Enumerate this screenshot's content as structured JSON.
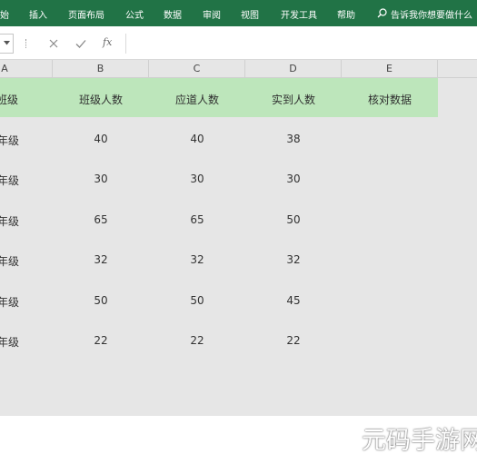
{
  "ribbon": {
    "tabs": [
      "始",
      "插入",
      "页面布局",
      "公式",
      "数据",
      "审阅",
      "视图",
      "开发工具",
      "帮助"
    ],
    "tell_me": "告诉我你想要做什么"
  },
  "formula_bar": {
    "fx_label": "fx",
    "value": ""
  },
  "columns": [
    "A",
    "B",
    "C",
    "D",
    "E"
  ],
  "header_row": [
    "班级",
    "班级人数",
    "应道人数",
    "实到人数",
    "核对数据"
  ],
  "rows": [
    {
      "grade": "年级",
      "class_size": "40",
      "expected": "40",
      "actual": "38"
    },
    {
      "grade": "年级",
      "class_size": "30",
      "expected": "30",
      "actual": "30"
    },
    {
      "grade": "年级",
      "class_size": "65",
      "expected": "65",
      "actual": "50"
    },
    {
      "grade": "年级",
      "class_size": "32",
      "expected": "32",
      "actual": "32"
    },
    {
      "grade": "年级",
      "class_size": "50",
      "expected": "50",
      "actual": "45"
    },
    {
      "grade": "年级",
      "class_size": "22",
      "expected": "22",
      "actual": "22"
    }
  ],
  "watermark": "元码手游网",
  "colors": {
    "ribbon": "#217346",
    "header_fill": "#bde6bb",
    "sheet_bg": "#e6e6e6"
  }
}
